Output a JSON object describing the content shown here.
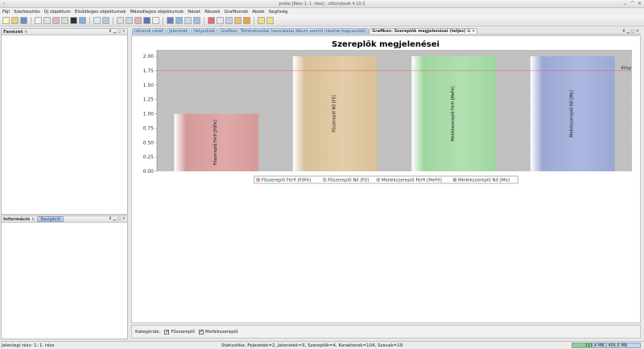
{
  "window": {
    "title": "proba [Rész 1: 1. rész] - oStorybook 4.10.2",
    "controls": [
      "⌄",
      "^",
      "✕"
    ]
  },
  "menu": [
    "Fájl",
    "Szerkesztés",
    "Új objektum",
    "Elsődleges objektumok",
    "Másodlagos objektumok",
    "Nézet",
    "Részek",
    "Grafikonok",
    "Ablak",
    "Segítség"
  ],
  "panels": {
    "left_top": {
      "title": "Fanézet",
      "icon": "↻",
      "controls": "⬆ ▁ ◻ ✕"
    },
    "left_bottom": {
      "title": "Információ",
      "icon": "↻",
      "tab": "Navigáció",
      "controls": "⬆ ▁ ◻ ✕"
    }
  },
  "tabs": [
    {
      "label": "Időrendi nézet",
      "active": false
    },
    {
      "label": "Jelenetek",
      "active": false
    },
    {
      "label": "Helyszínek",
      "active": false
    },
    {
      "label": "Grafikon: Történetszálak használatai dátum szerint (részher:kapcsolódó)",
      "active": false
    },
    {
      "label": "Grafikon: Szereplők megjelenései (teljes) ⊡ ✕",
      "active": true
    }
  ],
  "tab_controls": "⬆ ▁ ◻ ✕",
  "filter": {
    "label": "Kategóriák:",
    "options": [
      {
        "label": "Főszereplő",
        "checked": true
      },
      {
        "label": "Mellékszereplő",
        "checked": true
      }
    ]
  },
  "status": {
    "left": "Jelenlegi rész: 1: 1. rész",
    "stats": "Statisztika: Fejezetek=2, Jelenetek=3, Szereplők=4, Karakterek=104, Szavak=19",
    "memory": "113,4 MB / 405,5 MB",
    "memory_fraction": 0.28
  },
  "chart_data": {
    "type": "bar",
    "title": "Szereplők megjelenései",
    "categories": [
      "Főszereplő Férfi [FőFé]",
      "Főszereplő Nő [Fő]",
      "Mellékszereplő Férfi [MeFé]",
      "Mellékszereplő Nő [Me]"
    ],
    "values": [
      1.0,
      2.0,
      2.0,
      2.0
    ],
    "colors": [
      "#d49a9a",
      "#d8c098",
      "#9fd69f",
      "#9aa8d4"
    ],
    "ylim": [
      0,
      2.0
    ],
    "yticks": [
      "0.00",
      "0.25",
      "0.50",
      "0.75",
      "1.00",
      "1.25",
      "1.50",
      "1.75",
      "2.00"
    ],
    "average": 1.75,
    "average_label": "Átlag",
    "legend": [
      "Főszereplő Férfi [FőFé]",
      "Főszereplő Nő [Fő]",
      "Mellékszereplő Férfi [MeFé]",
      "Mellékszereplő Nő [Me]"
    ],
    "legend_position": "bottom",
    "grid": true
  }
}
